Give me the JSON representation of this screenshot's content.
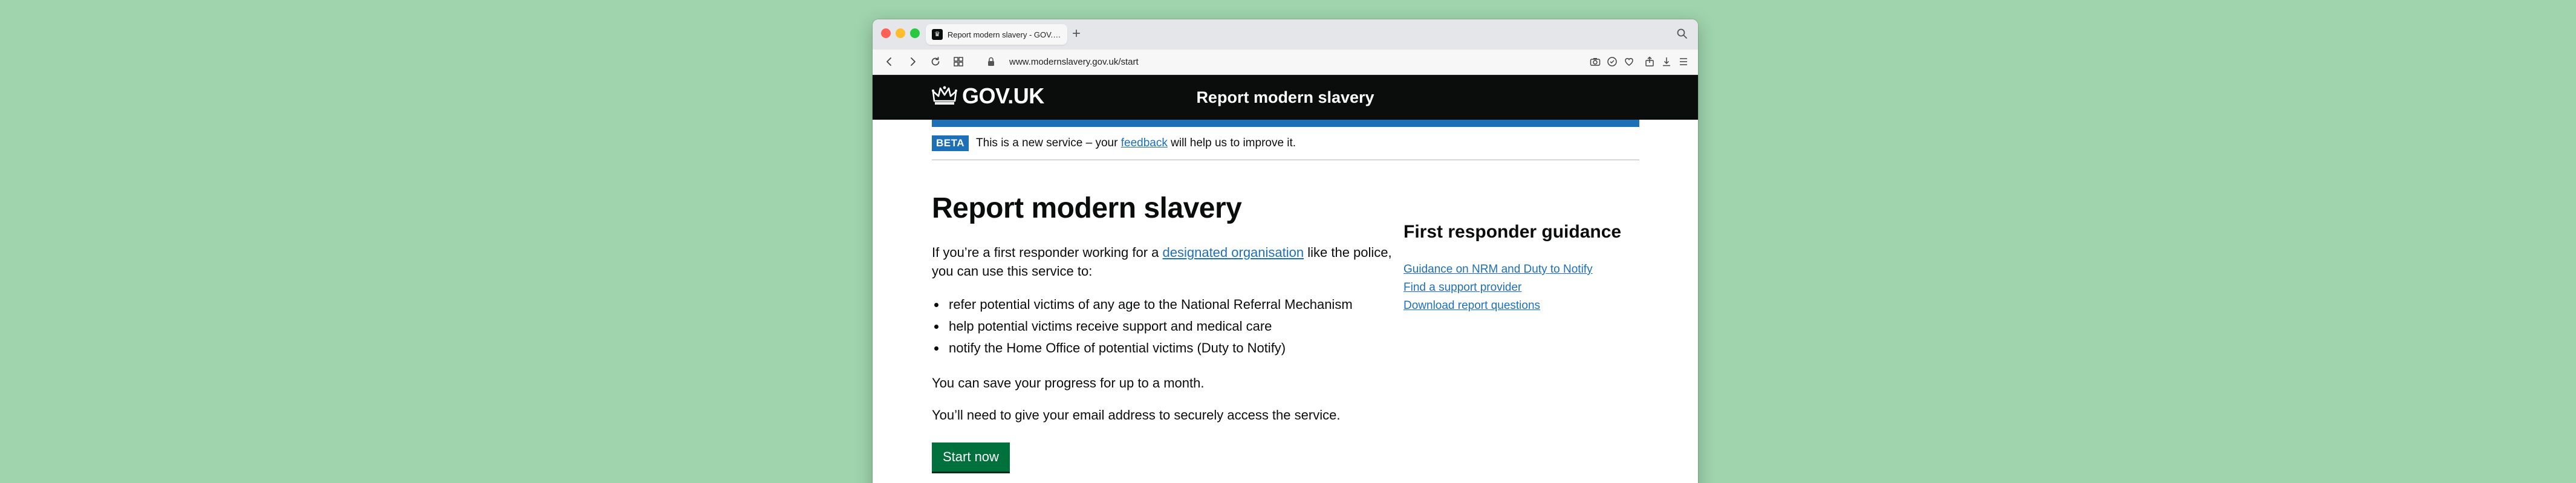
{
  "browser": {
    "tab_title": "Report modern slavery - GOV.UK",
    "favicon": "crown-favicon",
    "new_tab": "+",
    "url": "www.modernslavery.gov.uk/start"
  },
  "gov_header": {
    "logo_text": "GOV.UK",
    "service_name": "Report modern slavery"
  },
  "beta": {
    "tag": "BETA",
    "text_before": "This is a new service – your ",
    "link": "feedback",
    "text_after": " will help us to improve it."
  },
  "main": {
    "heading": "Report modern slavery",
    "intro_before": "If you’re a first responder working for a ",
    "intro_link": "designated organisation",
    "intro_after": " like the police, you can use this service to:",
    "bullets": [
      "refer potential victims of any age to the National Referral Mechanism",
      "help potential victims receive support and medical care",
      "notify the Home Office of potential victims (Duty to Notify)"
    ],
    "save_text": "You can save your progress for up to a month.",
    "email_text": "You’ll need to give your email address to securely access the service.",
    "start_button": "Start now"
  },
  "aside": {
    "heading": "First responder guidance",
    "links": [
      "Guidance on NRM and Duty to Notify",
      "Find a support provider",
      "Download report questions"
    ]
  },
  "colors": {
    "background": "#9fd4ad",
    "gov_black": "#0b0c0c",
    "gov_blue": "#1d70b8",
    "start_green": "#00703c"
  }
}
